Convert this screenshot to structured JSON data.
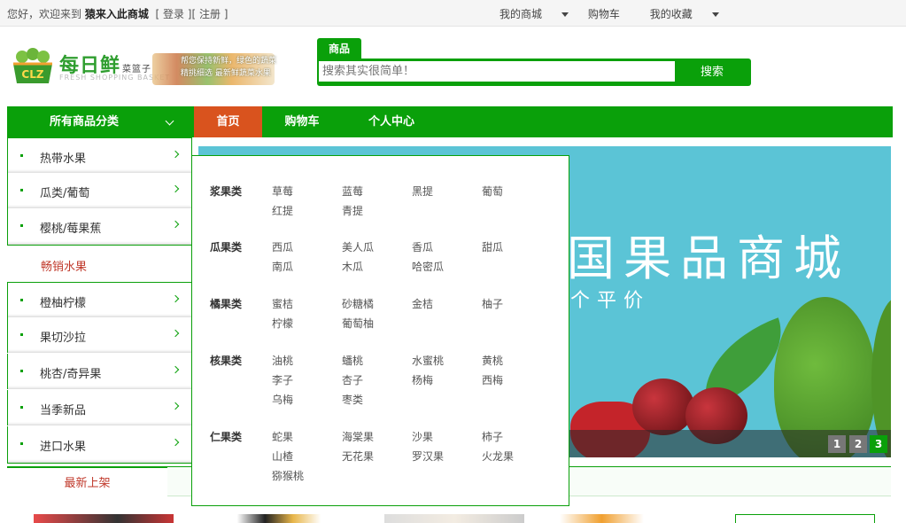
{
  "topbar": {
    "greeting": "您好，欢迎来到",
    "shop_name": "猿来入此商城",
    "login": "[ 登录 ]",
    "register": "[ 注册 ]",
    "my_mall": "我的商城",
    "cart": "购物车",
    "favorites": "我的收藏"
  },
  "logo": {
    "badge": "CLZ",
    "brand": "每日鲜",
    "brand_small": "菜篮子",
    "english": "FRESH SHOPPING BASKET",
    "slogan_1": "帮您保持新鲜，绿色的蔬菜",
    "slogan_2": "精挑细选 最新鲜蔬菜水果"
  },
  "search": {
    "tab_label": "商品",
    "placeholder": "搜索其实很简单！",
    "button": "搜索"
  },
  "nav": {
    "all_categories": "所有商品分类",
    "links": [
      "首页",
      "购物车",
      "个人中心"
    ]
  },
  "sidebar": {
    "items": [
      "热带水果",
      "瓜类/葡萄",
      "樱桃/莓果蕉",
      "畅销水果",
      "橙柚柠檬",
      "果切沙拉",
      "桃杏/奇异果",
      "当季新品",
      "进口水果"
    ]
  },
  "flyout": {
    "groups": [
      {
        "name": "浆果类",
        "items": [
          "草莓",
          "蓝莓",
          "黑提",
          "葡萄",
          "红提",
          "青提"
        ]
      },
      {
        "name": "瓜果类",
        "items": [
          "西瓜",
          "美人瓜",
          "香瓜",
          "甜瓜",
          "南瓜",
          "木瓜",
          "哈密瓜"
        ]
      },
      {
        "name": "橘果类",
        "items": [
          "蜜桔",
          "砂糖橘",
          "金桔",
          "柚子",
          "柠檬",
          "葡萄柚"
        ]
      },
      {
        "name": "核果类",
        "items": [
          "油桃",
          "蟠桃",
          "水蜜桃",
          "黄桃",
          "李子",
          "杏子",
          "杨梅",
          "西梅",
          "乌梅",
          "枣类"
        ]
      },
      {
        "name": "仁果类",
        "items": [
          "蛇果",
          "海棠果",
          "沙果",
          "柿子",
          "山楂",
          "无花果",
          "罗汉果",
          "火龙果",
          "猕猴桃"
        ]
      }
    ]
  },
  "banner": {
    "title": "国果品商城",
    "subtitle": "个平价",
    "pages": [
      "1",
      "2",
      "3"
    ],
    "active_page": 3
  },
  "latest": {
    "label": "最新上架"
  }
}
